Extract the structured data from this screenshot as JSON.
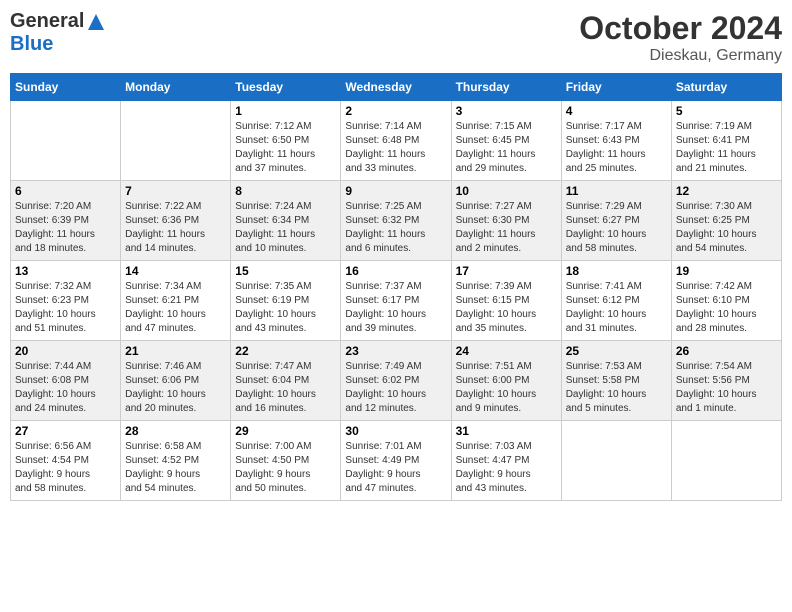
{
  "logo": {
    "general": "General",
    "blue": "Blue"
  },
  "header": {
    "month": "October 2024",
    "location": "Dieskau, Germany"
  },
  "weekdays": [
    "Sunday",
    "Monday",
    "Tuesday",
    "Wednesday",
    "Thursday",
    "Friday",
    "Saturday"
  ],
  "weeks": [
    [
      {
        "day": "",
        "info": ""
      },
      {
        "day": "",
        "info": ""
      },
      {
        "day": "1",
        "info": "Sunrise: 7:12 AM\nSunset: 6:50 PM\nDaylight: 11 hours\nand 37 minutes."
      },
      {
        "day": "2",
        "info": "Sunrise: 7:14 AM\nSunset: 6:48 PM\nDaylight: 11 hours\nand 33 minutes."
      },
      {
        "day": "3",
        "info": "Sunrise: 7:15 AM\nSunset: 6:45 PM\nDaylight: 11 hours\nand 29 minutes."
      },
      {
        "day": "4",
        "info": "Sunrise: 7:17 AM\nSunset: 6:43 PM\nDaylight: 11 hours\nand 25 minutes."
      },
      {
        "day": "5",
        "info": "Sunrise: 7:19 AM\nSunset: 6:41 PM\nDaylight: 11 hours\nand 21 minutes."
      }
    ],
    [
      {
        "day": "6",
        "info": "Sunrise: 7:20 AM\nSunset: 6:39 PM\nDaylight: 11 hours\nand 18 minutes."
      },
      {
        "day": "7",
        "info": "Sunrise: 7:22 AM\nSunset: 6:36 PM\nDaylight: 11 hours\nand 14 minutes."
      },
      {
        "day": "8",
        "info": "Sunrise: 7:24 AM\nSunset: 6:34 PM\nDaylight: 11 hours\nand 10 minutes."
      },
      {
        "day": "9",
        "info": "Sunrise: 7:25 AM\nSunset: 6:32 PM\nDaylight: 11 hours\nand 6 minutes."
      },
      {
        "day": "10",
        "info": "Sunrise: 7:27 AM\nSunset: 6:30 PM\nDaylight: 11 hours\nand 2 minutes."
      },
      {
        "day": "11",
        "info": "Sunrise: 7:29 AM\nSunset: 6:27 PM\nDaylight: 10 hours\nand 58 minutes."
      },
      {
        "day": "12",
        "info": "Sunrise: 7:30 AM\nSunset: 6:25 PM\nDaylight: 10 hours\nand 54 minutes."
      }
    ],
    [
      {
        "day": "13",
        "info": "Sunrise: 7:32 AM\nSunset: 6:23 PM\nDaylight: 10 hours\nand 51 minutes."
      },
      {
        "day": "14",
        "info": "Sunrise: 7:34 AM\nSunset: 6:21 PM\nDaylight: 10 hours\nand 47 minutes."
      },
      {
        "day": "15",
        "info": "Sunrise: 7:35 AM\nSunset: 6:19 PM\nDaylight: 10 hours\nand 43 minutes."
      },
      {
        "day": "16",
        "info": "Sunrise: 7:37 AM\nSunset: 6:17 PM\nDaylight: 10 hours\nand 39 minutes."
      },
      {
        "day": "17",
        "info": "Sunrise: 7:39 AM\nSunset: 6:15 PM\nDaylight: 10 hours\nand 35 minutes."
      },
      {
        "day": "18",
        "info": "Sunrise: 7:41 AM\nSunset: 6:12 PM\nDaylight: 10 hours\nand 31 minutes."
      },
      {
        "day": "19",
        "info": "Sunrise: 7:42 AM\nSunset: 6:10 PM\nDaylight: 10 hours\nand 28 minutes."
      }
    ],
    [
      {
        "day": "20",
        "info": "Sunrise: 7:44 AM\nSunset: 6:08 PM\nDaylight: 10 hours\nand 24 minutes."
      },
      {
        "day": "21",
        "info": "Sunrise: 7:46 AM\nSunset: 6:06 PM\nDaylight: 10 hours\nand 20 minutes."
      },
      {
        "day": "22",
        "info": "Sunrise: 7:47 AM\nSunset: 6:04 PM\nDaylight: 10 hours\nand 16 minutes."
      },
      {
        "day": "23",
        "info": "Sunrise: 7:49 AM\nSunset: 6:02 PM\nDaylight: 10 hours\nand 12 minutes."
      },
      {
        "day": "24",
        "info": "Sunrise: 7:51 AM\nSunset: 6:00 PM\nDaylight: 10 hours\nand 9 minutes."
      },
      {
        "day": "25",
        "info": "Sunrise: 7:53 AM\nSunset: 5:58 PM\nDaylight: 10 hours\nand 5 minutes."
      },
      {
        "day": "26",
        "info": "Sunrise: 7:54 AM\nSunset: 5:56 PM\nDaylight: 10 hours\nand 1 minute."
      }
    ],
    [
      {
        "day": "27",
        "info": "Sunrise: 6:56 AM\nSunset: 4:54 PM\nDaylight: 9 hours\nand 58 minutes."
      },
      {
        "day": "28",
        "info": "Sunrise: 6:58 AM\nSunset: 4:52 PM\nDaylight: 9 hours\nand 54 minutes."
      },
      {
        "day": "29",
        "info": "Sunrise: 7:00 AM\nSunset: 4:50 PM\nDaylight: 9 hours\nand 50 minutes."
      },
      {
        "day": "30",
        "info": "Sunrise: 7:01 AM\nSunset: 4:49 PM\nDaylight: 9 hours\nand 47 minutes."
      },
      {
        "day": "31",
        "info": "Sunrise: 7:03 AM\nSunset: 4:47 PM\nDaylight: 9 hours\nand 43 minutes."
      },
      {
        "day": "",
        "info": ""
      },
      {
        "day": "",
        "info": ""
      }
    ]
  ]
}
